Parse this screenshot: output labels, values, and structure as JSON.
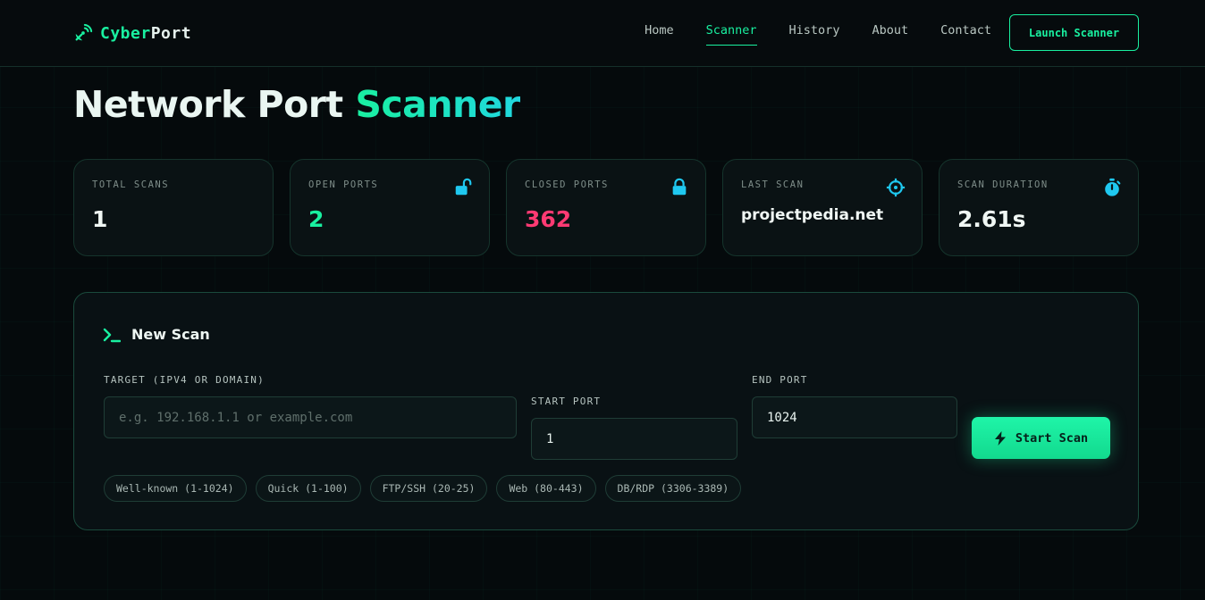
{
  "brand": {
    "name_a": "Cyber",
    "name_b": "Port"
  },
  "nav": {
    "items": [
      {
        "label": "Home"
      },
      {
        "label": "Scanner"
      },
      {
        "label": "History"
      },
      {
        "label": "About"
      },
      {
        "label": "Contact"
      }
    ],
    "active": "Scanner",
    "cta_label": "Launch Scanner"
  },
  "title": {
    "part_a": "Network Port",
    "part_b": "Scanner"
  },
  "stats": [
    {
      "label": "TOTAL SCANS",
      "value": "1",
      "icon": null
    },
    {
      "label": "OPEN PORTS",
      "value": "2",
      "icon": "unlock-icon"
    },
    {
      "label": "CLOSED PORTS",
      "value": "362",
      "icon": "lock-icon"
    },
    {
      "label": "LAST SCAN",
      "value": "projectpedia.net",
      "icon": "crosshair-icon"
    },
    {
      "label": "SCAN DURATION",
      "value": "2.61s",
      "icon": "stopwatch-icon"
    }
  ],
  "scan": {
    "title": "New Scan",
    "target_label": "TARGET (IPV4 OR DOMAIN)",
    "target_placeholder": "e.g. 192.168.1.1 or example.com",
    "target_value": "",
    "start_label": "START PORT",
    "start_value": "1",
    "end_label": "END PORT",
    "end_value": "1024",
    "button_label": "Start Scan",
    "presets": [
      "Well-known (1-1024)",
      "Quick (1-100)",
      "FTP/SSH (20-25)",
      "Web (80-443)",
      "DB/RDP (3306-3389)"
    ]
  },
  "colors": {
    "accent": "#19f0a0",
    "cyan": "#20d8e0",
    "danger": "#ff3a73",
    "background": "#050a0c"
  }
}
